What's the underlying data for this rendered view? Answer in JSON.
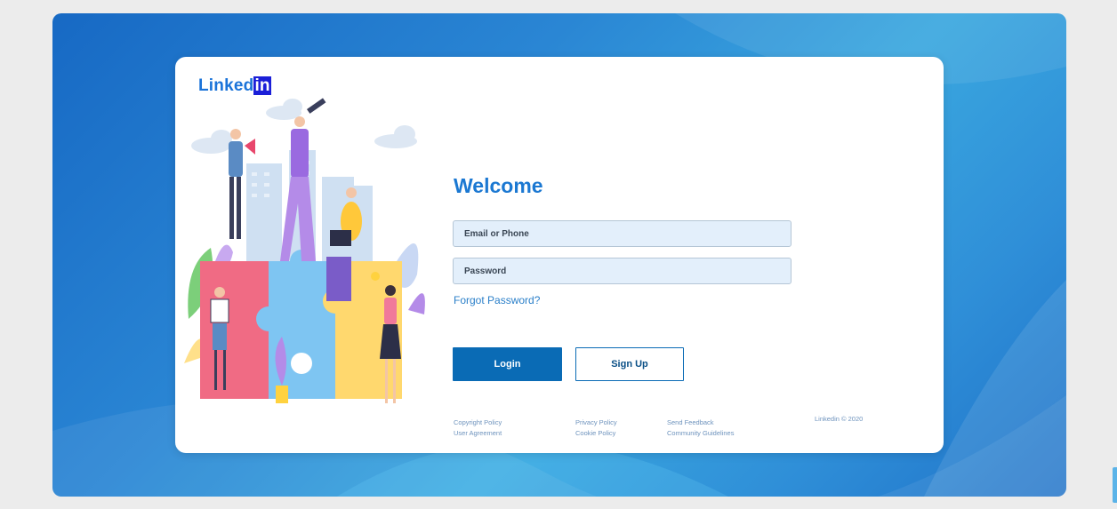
{
  "brand": {
    "logo_text": "Linked",
    "logo_badge": "in"
  },
  "form": {
    "heading": "Welcome",
    "email_placeholder": "Email or Phone",
    "password_placeholder": "Password",
    "forgot_link": "Forgot Password?",
    "login_label": "Login",
    "signup_label": "Sign Up"
  },
  "footer": {
    "col1": [
      "Copyright Policy",
      "User Agreement"
    ],
    "col2": [
      "Privacy Policy",
      "Cookie Policy"
    ],
    "col3": [
      "Send Feedback",
      "Community Guidelines"
    ],
    "copyright": "Linkedin © 2020"
  },
  "colors": {
    "accent": "#1b78d2",
    "button": "#0a6bb5",
    "background_blue": "#2a86d4",
    "field_bg": "#e3effb"
  }
}
